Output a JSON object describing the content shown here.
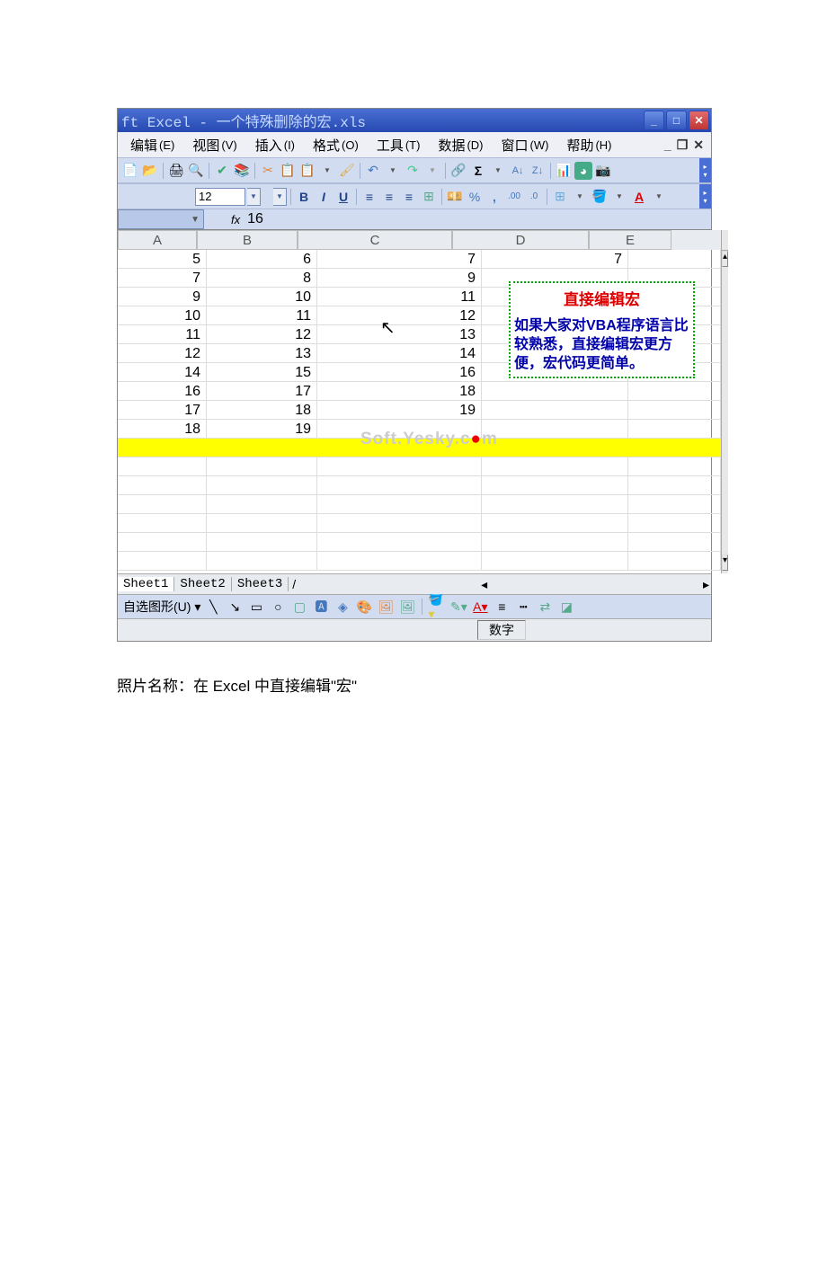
{
  "title": "ft Excel - 一个特殊删除的宏.xls",
  "menus": [
    {
      "label": "编辑",
      "key": "(E)"
    },
    {
      "label": "视图",
      "key": "(V)"
    },
    {
      "label": "插入",
      "key": "(I)"
    },
    {
      "label": "格式",
      "key": "(O)"
    },
    {
      "label": "工具",
      "key": "(T)"
    },
    {
      "label": "数据",
      "key": "(D)"
    },
    {
      "label": "窗口",
      "key": "(W)"
    },
    {
      "label": "帮助",
      "key": "(H)"
    }
  ],
  "fontsize": "12",
  "formula_value": "16",
  "columns": [
    "A",
    "B",
    "C",
    "D",
    "E"
  ],
  "rows": [
    {
      "A": "5",
      "B": "6",
      "C": "7",
      "D": "7"
    },
    {
      "A": "7",
      "B": "8",
      "C": "9"
    },
    {
      "A": "9",
      "B": "10",
      "C": "11"
    },
    {
      "A": "10",
      "B": "11",
      "C": "12"
    },
    {
      "A": "11",
      "B": "12",
      "C": "13"
    },
    {
      "A": "12",
      "B": "13",
      "C": "14"
    },
    {
      "A": "14",
      "B": "15",
      "C": "16"
    },
    {
      "A": "16",
      "B": "17",
      "C": "18"
    },
    {
      "A": "17",
      "B": "18",
      "C": "19"
    },
    {
      "A": "18",
      "B": "19",
      "C": ""
    }
  ],
  "callout": {
    "title": "直接编辑宏",
    "body": "如果大家对VBA程序语言比较熟悉，直接编辑宏更方便，宏代码更简单。"
  },
  "watermark": {
    "pre": "Soft.Yesky.c",
    "mid": "●",
    "post": "m"
  },
  "sheets": [
    "Sheet1",
    "Sheet2",
    "Sheet3"
  ],
  "drawlabel": "自选图形(U)",
  "status": "数字",
  "caption": "照片名称：在 Excel 中直接编辑\"宏\""
}
